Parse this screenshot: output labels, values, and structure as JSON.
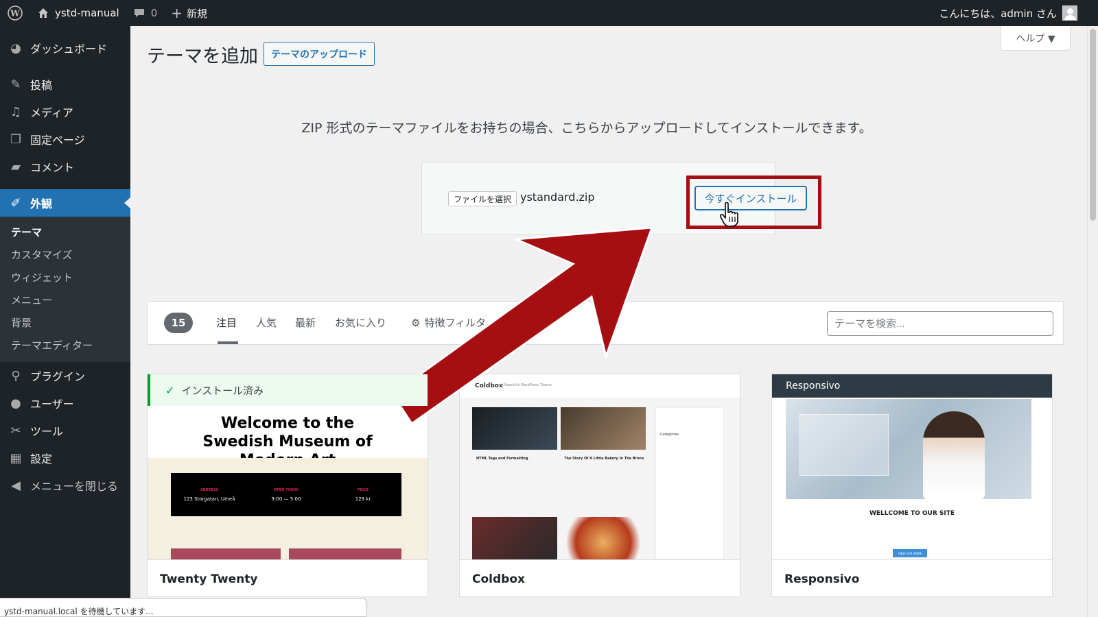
{
  "adminbar": {
    "site_name": "ystd-manual",
    "comments_count": "0",
    "new_label": "新規",
    "greeting": "こんにちは、admin さん"
  },
  "sidebar": {
    "items": [
      {
        "label": "ダッシュボード",
        "icon": "dashboard-icon"
      },
      {
        "label": "投稿",
        "icon": "pin-icon"
      },
      {
        "label": "メディア",
        "icon": "media-icon"
      },
      {
        "label": "固定ページ",
        "icon": "page-icon"
      },
      {
        "label": "コメント",
        "icon": "comment-icon"
      },
      {
        "label": "外観",
        "icon": "appearance-icon"
      },
      {
        "label": "プラグイン",
        "icon": "plugin-icon"
      },
      {
        "label": "ユーザー",
        "icon": "user-icon"
      },
      {
        "label": "ツール",
        "icon": "wrench-icon"
      },
      {
        "label": "設定",
        "icon": "settings-icon"
      },
      {
        "label": "メニューを閉じる",
        "icon": "collapse-icon"
      }
    ],
    "submenu": [
      "テーマ",
      "カスタマイズ",
      "ウィジェット",
      "メニュー",
      "背景",
      "テーマエディター"
    ]
  },
  "header": {
    "title": "テーマを追加",
    "upload_button": "テーマのアップロード",
    "help_button": "ヘルプ ▼"
  },
  "upload": {
    "description": "ZIP 形式のテーマファイルをお持ちの場合、こちらからアップロードしてインストールできます。",
    "file_button": "ファイルを選択",
    "file_name": "ystandard.zip",
    "install_button": "今すぐインストール"
  },
  "filter": {
    "count": "15",
    "tabs": [
      "注目",
      "人気",
      "最新",
      "お気に入り",
      "特徴フィルタ"
    ],
    "search_placeholder": "テーマを検索..."
  },
  "themes": [
    {
      "name": "Twenty Twenty",
      "installed_label": "インストール済み",
      "preview_title": "Welcome to the Swedish Museum of Modern Art",
      "info": [
        {
          "label": "ADDRESS",
          "value": "123 Storgatan, Umeå"
        },
        {
          "label": "OPEN TODAY",
          "value": "9:00 — 5:00"
        },
        {
          "label": "PRICE",
          "value": "129 kr"
        }
      ]
    },
    {
      "name": "Coldbox",
      "preview_logo": "Coldbox",
      "preview_tagline": "A Beautiful WordPress Theme",
      "post_titles": [
        "HTML Tags and Formatting",
        "The Story Of A Little Bakery In The Bronx"
      ],
      "sidebar_heading": "Categories"
    },
    {
      "name": "Responsivo",
      "preview_logo": "Responsivo",
      "welcome": "WELLCOME TO OUR SITE",
      "button": "VIEW OUR WORK"
    }
  ],
  "status_bar": "ystd-manual.local を待機しています...",
  "colors": {
    "admin_dark": "#1d2327",
    "accent_blue": "#2271b1",
    "highlight_red": "#a50f12"
  }
}
